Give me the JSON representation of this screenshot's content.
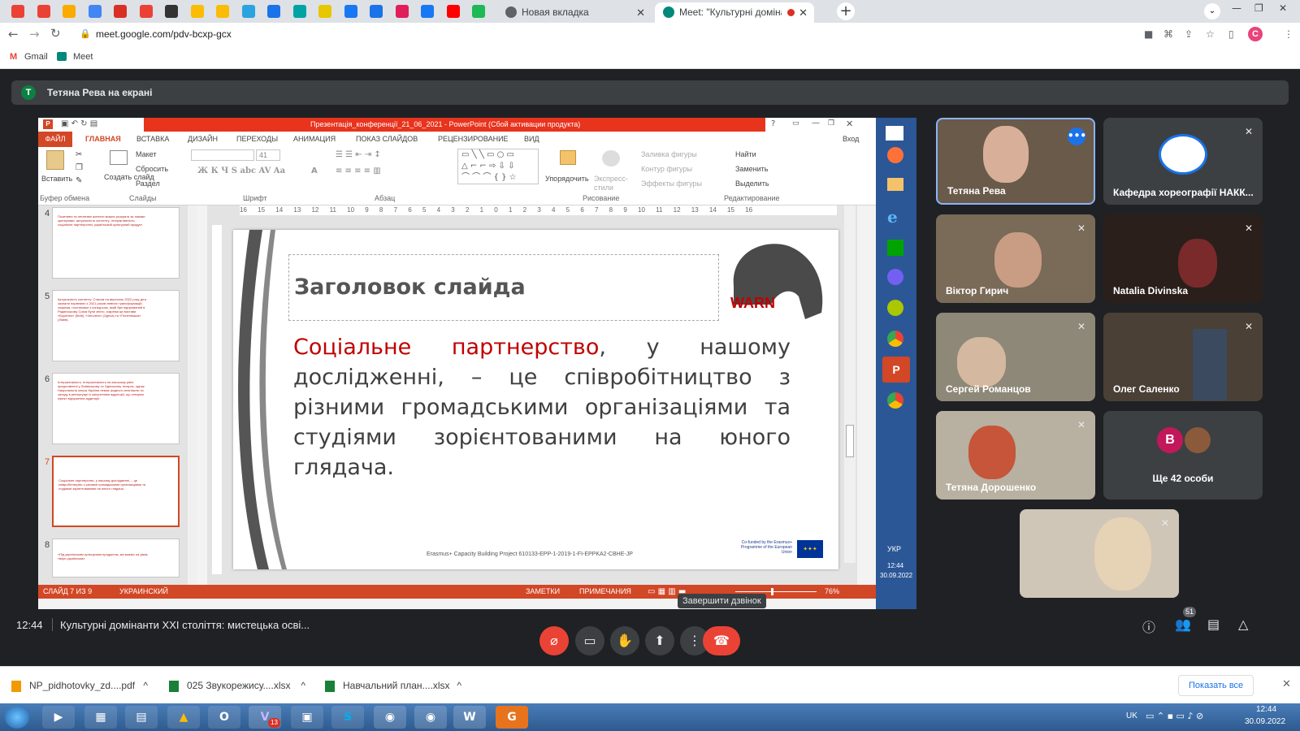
{
  "browser": {
    "tabs": [
      {
        "label": "Новая вкладка"
      },
      {
        "label": "Meet: \"Культурні домінанти"
      }
    ],
    "url": "meet.google.com/pdv-bcxp-gcx",
    "bookmarks": [
      "Gmail",
      "Meet"
    ],
    "pinned_tab_icons": [
      "gmail-icon",
      "gmail-icon",
      "drive-icon",
      "google-icon",
      "doc-icon",
      "gmail-icon",
      "font-icon",
      "sheet-icon",
      "sheet-icon",
      "telegram-icon",
      "feather-icon",
      "app-icon",
      "bold-icon",
      "facebook-icon",
      "contact-icon",
      "slack-icon",
      "facebook-icon",
      "youtube-icon",
      "spotify-icon"
    ]
  },
  "meet": {
    "presenter_banner": "Тетяна Рева на екрані",
    "presenter_initial": "T",
    "time": "12:44",
    "meeting_title": "Культурні домінанти ХХІ століття: мистецька осві...",
    "tooltip": "Завершити дзвінок",
    "people_badge": "51",
    "participants": [
      {
        "name": "Тетяна Рева"
      },
      {
        "name": "Кафедра хореографії НАКК..."
      },
      {
        "name": "Віктор Гирич"
      },
      {
        "name": "Natalia Divinska"
      },
      {
        "name": "Сергей Романцов"
      },
      {
        "name": "Олег Саленко"
      },
      {
        "name": "Тетяна Дорошенко"
      },
      {
        "name": "Ще 42 особи",
        "initial": "B"
      },
      {
        "name": ""
      }
    ]
  },
  "powerpoint": {
    "title": "Презентація_конференції_21_06_2021 - PowerPoint (Сбой активации продукта)",
    "login": "Вход",
    "ribbon_tabs": [
      "ФАЙЛ",
      "ГЛАВНАЯ",
      "ВСТАВКА",
      "ДИЗАЙН",
      "ПЕРЕХОДЫ",
      "АНИМАЦИЯ",
      "ПОКАЗ СЛАЙДОВ",
      "РЕЦЕНЗИРОВАНИЕ",
      "ВИД"
    ],
    "groups": [
      "Буфер обмена",
      "Слайды",
      "Шрифт",
      "Абзац",
      "Рисование",
      "Редактирование"
    ],
    "buttons": {
      "paste": "Вставить",
      "new_slide": "Создать слайд",
      "layout": "Макет",
      "reset": "Сбросить",
      "section": "Раздел",
      "font_size": "41",
      "arrange": "Упорядочить",
      "quick_styles": "Экспресс-стили",
      "fill": "Заливка фигуры",
      "outline": "Контур фигуры",
      "effects": "Эффекты фигуры",
      "find": "Найти",
      "replace": "Заменить",
      "select": "Выделить"
    },
    "thumbnails": [
      {
        "num": "4",
        "text": "Позитивні та негативні аспекти можна розкрити за такими критеріями: актуальність контенту; інтерактивність; соціальне партнерство; український культурний продукт"
      },
      {
        "num": "5",
        "text": "Актуальність контенту. Станом на вересень 2022 року діти зазнали порівняно з 2021 роком певних трансформацій, зокрема, постановки з конкурсом, який був підтриманий в Радянському Союзі були знято, зокрема це вистави «Буратіно» (Київ), «Чіполіно» (Одеса) та «Попелюшка» (Львів)."
      },
      {
        "num": "6",
        "text": "Інтерактивність. Інтерактивність на високому рівні представлені у Львівському та Одеському театрах, однак Національна опера України немає жодного спектаклю та заходу в репертуарі із залученням аудиторії, що створює ефект відчуження аудиторії."
      },
      {
        "num": "7",
        "text": "Соціальне партнерство, у нашому дослідженні, – це співробітництво з різними громадськими організаціями та студіями зорієнтованими на юного глядача."
      },
      {
        "num": "8",
        "text": "«Під українським культурним продуктом, ми маємо на увазі, твори українських"
      }
    ],
    "slide": {
      "title_placeholder": "Заголовок слайда",
      "body_highlight": "Соціальне партнерство",
      "body_rest": ", у нашому дослідженні, – це співробітництво з різними громадськими організаціями та студіями зорієнтованими на юного глядача.",
      "logo_text": "WARN",
      "footer": "Erasmus+ Capacity Building Project 610133-EPP-1-2019-1-FI-EPPKA2-CBHE-JP",
      "eu_text": "Co-funded by the Erasmus+ Programme of the European Union"
    },
    "status": {
      "slide": "СЛАЙД 7 ИЗ 9",
      "lang": "УКРАИНСКИЙ",
      "notes": "ЗАМЕТКИ",
      "comments": "ПРИМЕЧАНИЯ",
      "zoom": "76%"
    },
    "ruler": "16 15 14 13 12 11 10 9 8 7 6 5 4 3 2 1 0 1 2 3 4 5 6 7 8 9 10 11 12 13 14 15 16"
  },
  "remote_tray": {
    "lang": "УКР",
    "time": "12:44",
    "date": "30.09.2022"
  },
  "downloads": {
    "files": [
      "NP_pidhotovky_zd....pdf",
      "025 Звукорежису....xlsx",
      "Навчальний план....xlsx"
    ],
    "show_all": "Показать все"
  },
  "taskbar": {
    "lang": "UK",
    "time": "12:44",
    "date": "30.09.2022",
    "viber_badge": "13"
  },
  "colors": {
    "accent_red": "#ea4335",
    "ppt_orange": "#d24726",
    "slide_red": "#c00000",
    "meet_bg": "#202124"
  }
}
